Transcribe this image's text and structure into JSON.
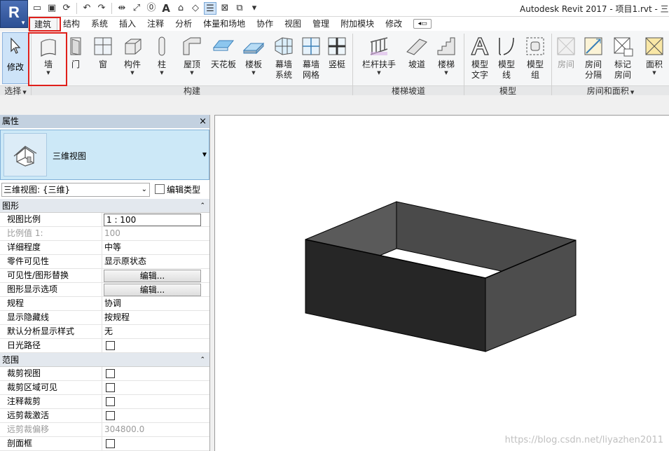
{
  "window": {
    "title": "Autodesk Revit 2017 -     项目1.rvt - 三"
  },
  "app_button": {
    "letter": "R",
    "icon": "revit-logo-icon"
  },
  "qat": {
    "icons": [
      "open-icon",
      "save-icon",
      "sync-icon",
      "undo-icon",
      "redo-icon",
      "measure-icon",
      "dimension-icon",
      "tag-icon",
      "text-icon",
      "3d-view-icon",
      "section-icon",
      "thin-lines-icon",
      "close-hidden-icon",
      "switch-windows-icon",
      "customize-icon"
    ],
    "text_icon_glyph": "A"
  },
  "tabs": [
    "建筑",
    "结构",
    "系统",
    "插入",
    "注释",
    "分析",
    "体量和场地",
    "协作",
    "视图",
    "管理",
    "附加模块",
    "修改"
  ],
  "active_tab": 0,
  "ribbon": {
    "modify": {
      "label": "修改"
    },
    "build_tools": [
      {
        "label": "墙",
        "icon": "wall-icon",
        "dropdown": true
      },
      {
        "label": "门",
        "icon": "door-icon"
      },
      {
        "label": "窗",
        "icon": "window-icon"
      },
      {
        "label": "构件",
        "icon": "component-icon",
        "dropdown": true
      },
      {
        "label": "柱",
        "icon": "column-icon",
        "dropdown": true
      },
      {
        "label": "屋顶",
        "icon": "roof-icon",
        "dropdown": true
      },
      {
        "label": "天花板",
        "icon": "ceiling-icon"
      },
      {
        "label": "楼板",
        "icon": "floor-icon",
        "dropdown": true
      },
      {
        "label": "幕墙\n系统",
        "icon": "curtain-system-icon"
      },
      {
        "label": "幕墙\n网格",
        "icon": "curtain-grid-icon"
      },
      {
        "label": "竖梃",
        "icon": "mullion-icon"
      }
    ],
    "circulation_tools": [
      {
        "label": "栏杆扶手",
        "icon": "railing-icon",
        "dropdown": true
      },
      {
        "label": "坡道",
        "icon": "ramp-icon"
      },
      {
        "label": "楼梯",
        "icon": "stair-icon",
        "dropdown": true
      }
    ],
    "model_tools": [
      {
        "label": "模型\n文字",
        "icon": "model-text-icon"
      },
      {
        "label": "模型\n线",
        "icon": "model-line-icon"
      },
      {
        "label": "模型\n组",
        "icon": "model-group-icon",
        "dropdown": true
      }
    ],
    "room_tools": [
      {
        "label": "房间",
        "icon": "room-icon",
        "disabled": true
      },
      {
        "label": "房间\n分隔",
        "icon": "room-separator-icon"
      },
      {
        "label": "标记\n房间",
        "icon": "tag-room-icon",
        "dropdown": true
      },
      {
        "label": "面积",
        "icon": "area-icon",
        "dropdown": true
      }
    ],
    "panels": {
      "select": "选择",
      "build": "构建",
      "circulation": "楼梯坡道",
      "model": "模型",
      "room": "房间和面积"
    }
  },
  "properties": {
    "title": "属性",
    "close": "×",
    "type_name": "三维视图",
    "view_selector": "三维视图: {三维}",
    "edit_type": "编辑类型",
    "groups": [
      {
        "name": "图形",
        "rows": [
          {
            "key": "视图比例",
            "value": "1 : 100",
            "style": "boxed"
          },
          {
            "key": "比例值 1:",
            "value": "100",
            "style": "dim"
          },
          {
            "key": "详细程度",
            "value": "中等"
          },
          {
            "key": "零件可见性",
            "value": "显示原状态"
          },
          {
            "key": "可见性/图形替换",
            "value": "编辑...",
            "style": "button"
          },
          {
            "key": "图形显示选项",
            "value": "编辑...",
            "style": "button"
          },
          {
            "key": "规程",
            "value": "协调"
          },
          {
            "key": "显示隐藏线",
            "value": "按规程"
          },
          {
            "key": "默认分析显示样式",
            "value": "无"
          },
          {
            "key": "日光路径",
            "value": "",
            "style": "checkbox"
          }
        ]
      },
      {
        "name": "范围",
        "rows": [
          {
            "key": "裁剪视图",
            "value": "",
            "style": "checkbox"
          },
          {
            "key": "裁剪区域可见",
            "value": "",
            "style": "checkbox"
          },
          {
            "key": "注释裁剪",
            "value": "",
            "style": "checkbox"
          },
          {
            "key": "远剪裁激活",
            "value": "",
            "style": "checkbox"
          },
          {
            "key": "远剪裁偏移",
            "value": "304800.0",
            "style": "dim"
          },
          {
            "key": "剖面框",
            "value": "",
            "style": "checkbox"
          }
        ]
      }
    ],
    "collapse_glyph": "⌃"
  },
  "viewport": {
    "watermark": "https://blog.csdn.net/liyazhen2011"
  },
  "colors": {
    "highlight": "#e0201b",
    "box_dark": "#262626",
    "box_side": "#4a4a4a",
    "box_inner": "#5a5a5a"
  }
}
